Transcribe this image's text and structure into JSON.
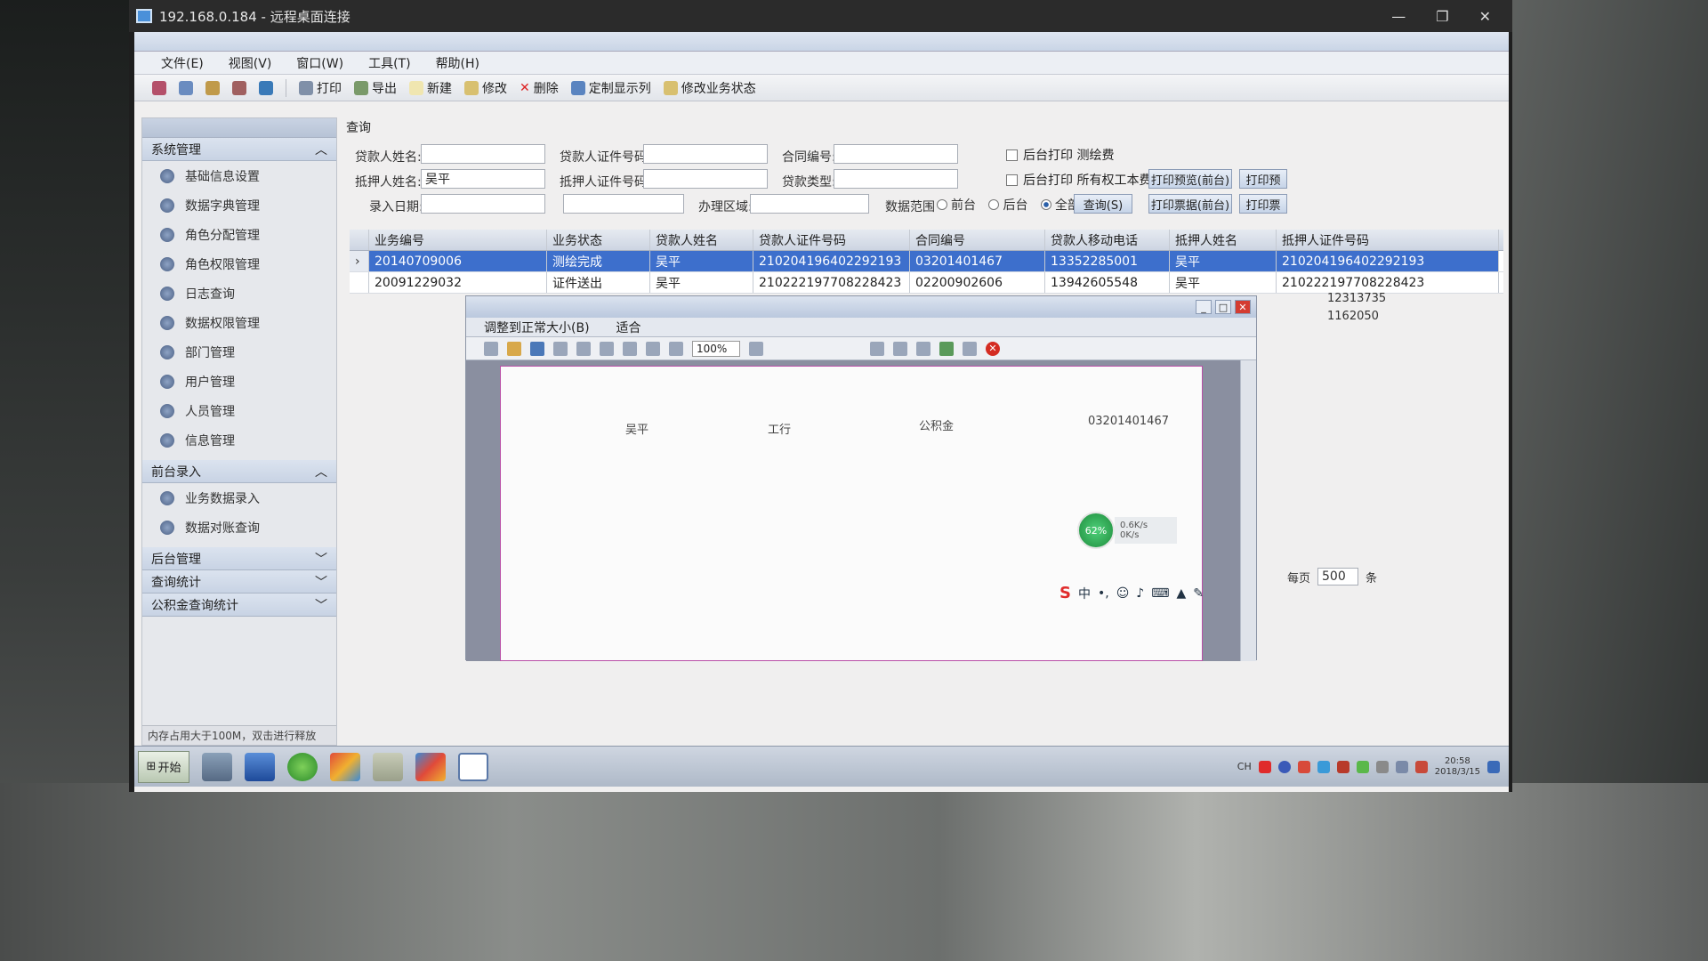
{
  "rdp": {
    "title": "192.168.0.184 - 远程桌面连接",
    "controls": [
      "—",
      "❐",
      "✕"
    ]
  },
  "menu": [
    "文件(E)",
    "视图(V)",
    "窗口(W)",
    "工具(T)",
    "帮助(H)"
  ],
  "toolbar": {
    "print": "打印",
    "export": "导出",
    "new": "新建",
    "edit": "修改",
    "delete": "删除",
    "custom_columns": "定制显示列",
    "modify_status": "修改业务状态"
  },
  "sidebar": {
    "system_group": "系统管理",
    "system_items": [
      "基础信息设置",
      "数据字典管理",
      "角色分配管理",
      "角色权限管理",
      "日志查询",
      "数据权限管理",
      "部门管理",
      "用户管理",
      "人员管理",
      "信息管理"
    ],
    "front_group": "前台录入",
    "front_items": [
      "业务数据录入",
      "数据对账查询"
    ],
    "back_group": "后台管理",
    "stats_group": "查询统计",
    "fund_group": "公积金查询统计",
    "status": "内存占用大于100M，双击进行释放"
  },
  "query": {
    "panel_title": "查询",
    "borrower_name_label": "贷款人姓名:",
    "borrower_id_label": "贷款人证件号码:",
    "contract_no_label": "合同编号:",
    "mortgagor_name_label": "抵押人姓名:",
    "mortgagor_name_value": "吴平",
    "mortgagor_id_label": "抵押人证件号码:",
    "loan_type_label": "贷款类型:",
    "entry_date_label": "录入日期:",
    "handle_area_label": "办理区域:",
    "data_scope_label": "数据范围",
    "scope_options": [
      "前台",
      "后台",
      "全部"
    ],
    "chk_print_survey": "后台打印 测绘费",
    "chk_print_all": "后台打印 所有权工本费",
    "btn_print_survey": "打印预览(前台)",
    "btn_print_receipt": "打印票据(前台)",
    "btn_print_more": "打印预",
    "btn_print_more2": "打印票",
    "btn_query": "查询(S)"
  },
  "grid": {
    "headers": [
      "业务编号",
      "业务状态",
      "贷款人姓名",
      "贷款人证件号码",
      "合同编号",
      "贷款人移动电话",
      "抵押人姓名",
      "抵押人证件号码"
    ],
    "rows": [
      [
        "20140709006",
        "测绘完成",
        "吴平",
        "210204196402292193",
        "03201401467",
        "13352285001",
        "吴平",
        "210204196402292193"
      ],
      [
        "20091229032",
        "证件送出",
        "吴平",
        "210222197708228423",
        "02200902606",
        "13942605548",
        "吴平",
        "210222197708228423"
      ]
    ],
    "extra_cells": [
      "12313735",
      "1162050"
    ]
  },
  "preview": {
    "opt_fit": "调整到正常大小(B)",
    "opt_fit2": "适合",
    "zoom": "100%",
    "page_texts": [
      "吴平",
      "工行",
      "公积金",
      "03201401467"
    ]
  },
  "pager": {
    "label": "每页",
    "value": "500",
    "suffix": "条"
  },
  "network": {
    "percent": "62%",
    "up": "0.6K/s",
    "down": "0K/s"
  },
  "taskbar": {
    "start": "开始",
    "lang": "CH",
    "time": "20:58",
    "date": "2018/3/15"
  },
  "ime": {
    "logo": "S",
    "mode": "中"
  },
  "colors": {
    "selection": "#3d6fcc",
    "accent": "#2a5fa8"
  }
}
